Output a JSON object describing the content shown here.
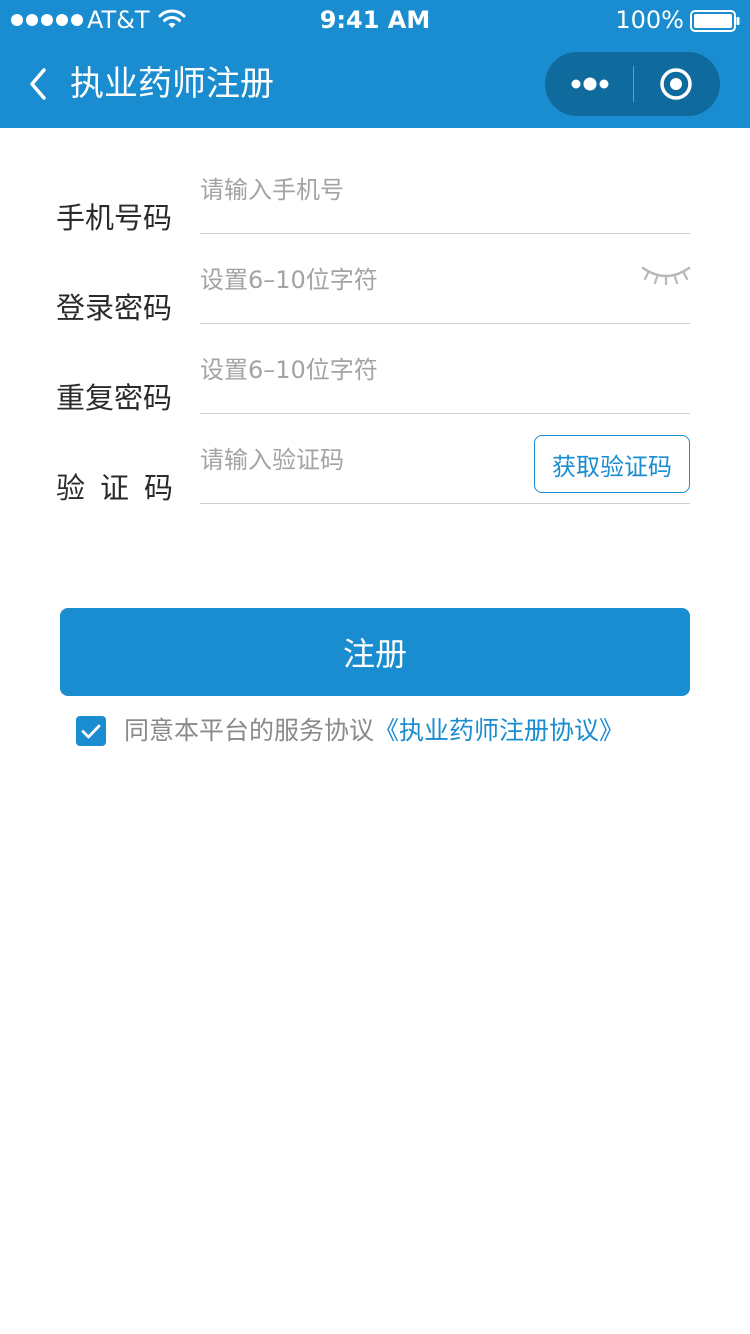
{
  "status_bar": {
    "carrier": "AT&T",
    "time": "9:41 AM",
    "battery": "100%"
  },
  "nav": {
    "title": "执业药师注册"
  },
  "form": {
    "phone": {
      "label": "手机号码",
      "placeholder": "请输入手机号"
    },
    "password": {
      "label": "登录密码",
      "placeholder": "设置6–10位字符"
    },
    "repeat_password": {
      "label": "重复密码",
      "placeholder": "设置6–10位字符"
    },
    "code": {
      "label": "验证码",
      "placeholder": "请输入验证码",
      "button_label": "获取验证码"
    }
  },
  "register_button": "注册",
  "agreement": {
    "checked": true,
    "text": "同意本平台的服务协议",
    "link": "《执业药师注册协议》"
  },
  "colors": {
    "accent": "#1a8cd0",
    "capsule": "#0f6b9e",
    "placeholder": "#a3a3a3",
    "label": "#2b2b2b"
  },
  "icons": [
    "signal-icon",
    "wifi-icon",
    "battery-icon",
    "back-icon",
    "more-icon",
    "close-target-icon",
    "eye-closed-icon",
    "checkmark-icon"
  ]
}
